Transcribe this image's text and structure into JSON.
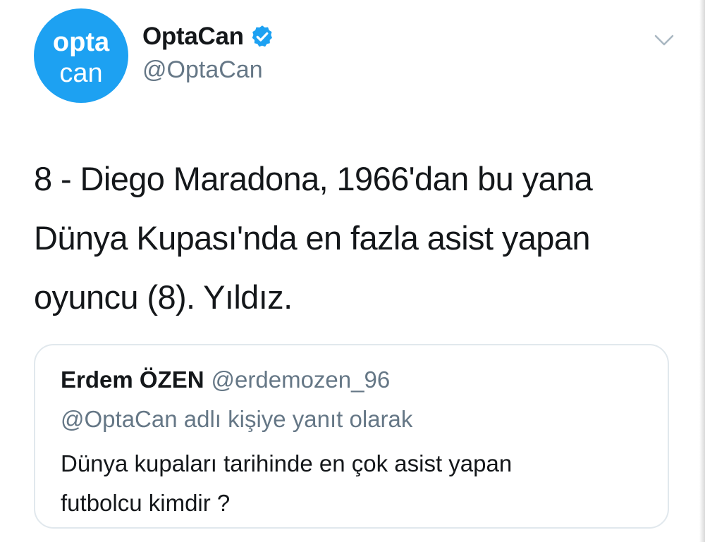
{
  "author": {
    "avatar_text_top": "opta",
    "avatar_text_bottom": "can",
    "display_name": "OptaCan",
    "handle": "@OptaCan",
    "verified": true
  },
  "tweet": {
    "lines": [
      "8 - Diego Maradona, 1966'dan bu yana",
      "Dünya Kupası'nda en fazla asist yapan",
      "oyuncu (8). Yıldız."
    ]
  },
  "quoted_tweet": {
    "display_name": "Erdem ÖZEN",
    "handle": "@erdemozen_96",
    "reply_context": "@OptaCan adlı kişiye yanıt olarak",
    "lines": [
      "Dünya kupaları tarihinde en çok asist yapan",
      "futbolcu kimdir ?"
    ]
  },
  "colors": {
    "accent": "#1da1f2",
    "secondary_text": "#657786",
    "primary_text": "#14171a",
    "border": "#e1e8ed"
  },
  "icons": {
    "verified": "verified-badge-icon",
    "menu": "chevron-down-icon"
  }
}
